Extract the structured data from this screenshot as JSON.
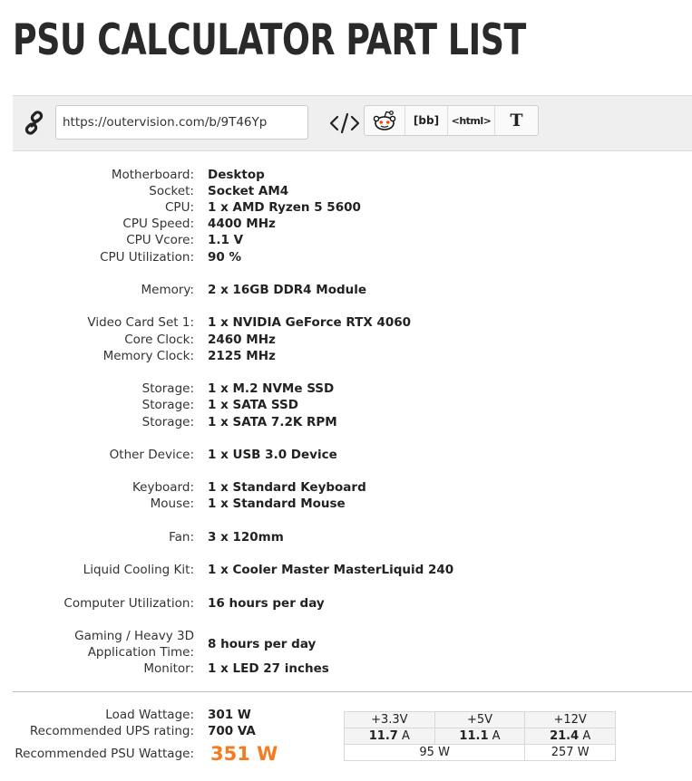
{
  "header": {
    "title": "PSU CALCULATOR PART LIST"
  },
  "share": {
    "url": "https://outervision.com/b/9T46Yp",
    "buttons": {
      "bb": "[bb]",
      "html": "<html>",
      "text": "T"
    },
    "icons": [
      "link-icon",
      "embed-code-icon",
      "reddit-icon"
    ]
  },
  "specs": [
    {
      "label": "Motherboard:",
      "value": "Desktop"
    },
    {
      "label": "Socket:",
      "value": "Socket AM4"
    },
    {
      "label": "CPU:",
      "value": "1 x AMD Ryzen 5 5600"
    },
    {
      "label": "CPU Speed:",
      "value": "4400 MHz"
    },
    {
      "label": "CPU Vcore:",
      "value": "1.1 V"
    },
    {
      "label": "CPU Utilization:",
      "value": "90 %"
    },
    {
      "label": "Memory:",
      "value": "2 x 16GB DDR4 Module"
    },
    {
      "label": "Video Card Set 1:",
      "value": "1 x NVIDIA GeForce RTX 4060"
    },
    {
      "label": "Core Clock:",
      "value": "2460 MHz"
    },
    {
      "label": "Memory Clock:",
      "value": "2125 MHz"
    },
    {
      "label": "Storage:",
      "value": "1 x M.2 NVMe SSD"
    },
    {
      "label": "Storage:",
      "value": "1 x SATA SSD"
    },
    {
      "label": "Storage:",
      "value": "1 x SATA 7.2K RPM"
    },
    {
      "label": "Other Device:",
      "value": "1 x USB 3.0 Device"
    },
    {
      "label": "Keyboard:",
      "value": "1 x Standard Keyboard"
    },
    {
      "label": "Mouse:",
      "value": "1 x Standard Mouse"
    },
    {
      "label": "Fan:",
      "value": "3 x 120mm"
    },
    {
      "label": "Liquid Cooling Kit:",
      "value": "1 x Cooler Master MasterLiquid 240"
    },
    {
      "label": "Computer Utilization:",
      "value": "16 hours per day"
    },
    {
      "label_line1": "Gaming / Heavy 3D",
      "label_line2": "Application Time:",
      "value": "8 hours per day"
    },
    {
      "label": "Monitor:",
      "value": "1 x LED 27 inches"
    }
  ],
  "summary": {
    "load_label": "Load Wattage:",
    "load_value": "301 W",
    "ups_label": "Recommended UPS rating:",
    "ups_value": "700 VA",
    "psu_label": "Recommended PSU Wattage:",
    "psu_value": "351 W"
  },
  "rails": {
    "headers": [
      "+3.3V",
      "+5V",
      "+12V"
    ],
    "amps": [
      "11.7",
      "11.1",
      "21.4"
    ],
    "amp_unit": "A",
    "watts_low": "95 W",
    "watts_12v": "257 W"
  },
  "colors": {
    "accent": "#f47b20",
    "bar_bg": "#efefef",
    "title": "#2a2a2a"
  }
}
